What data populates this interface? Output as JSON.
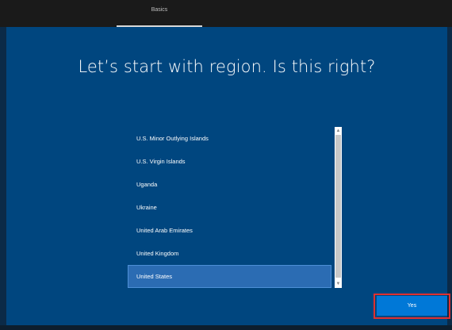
{
  "header": {
    "tab_label": "Basics"
  },
  "main": {
    "headline": "Let’s start with region. Is this right?"
  },
  "region_list": {
    "items": [
      "U.S. Minor Outlying Islands",
      "U.S. Virgin Islands",
      "Uganda",
      "Ukraine",
      "United Arab Emirates",
      "United Kingdom",
      "United States"
    ],
    "selected": "United States"
  },
  "footer": {
    "yes_label": "Yes"
  },
  "colors": {
    "background": "#00467f",
    "accent": "#0078d7",
    "selection": "#2b6cb3",
    "highlight_border": "#e03030"
  },
  "icons": {
    "scroll_up": "chevron-up-icon",
    "scroll_down": "chevron-down-icon"
  }
}
